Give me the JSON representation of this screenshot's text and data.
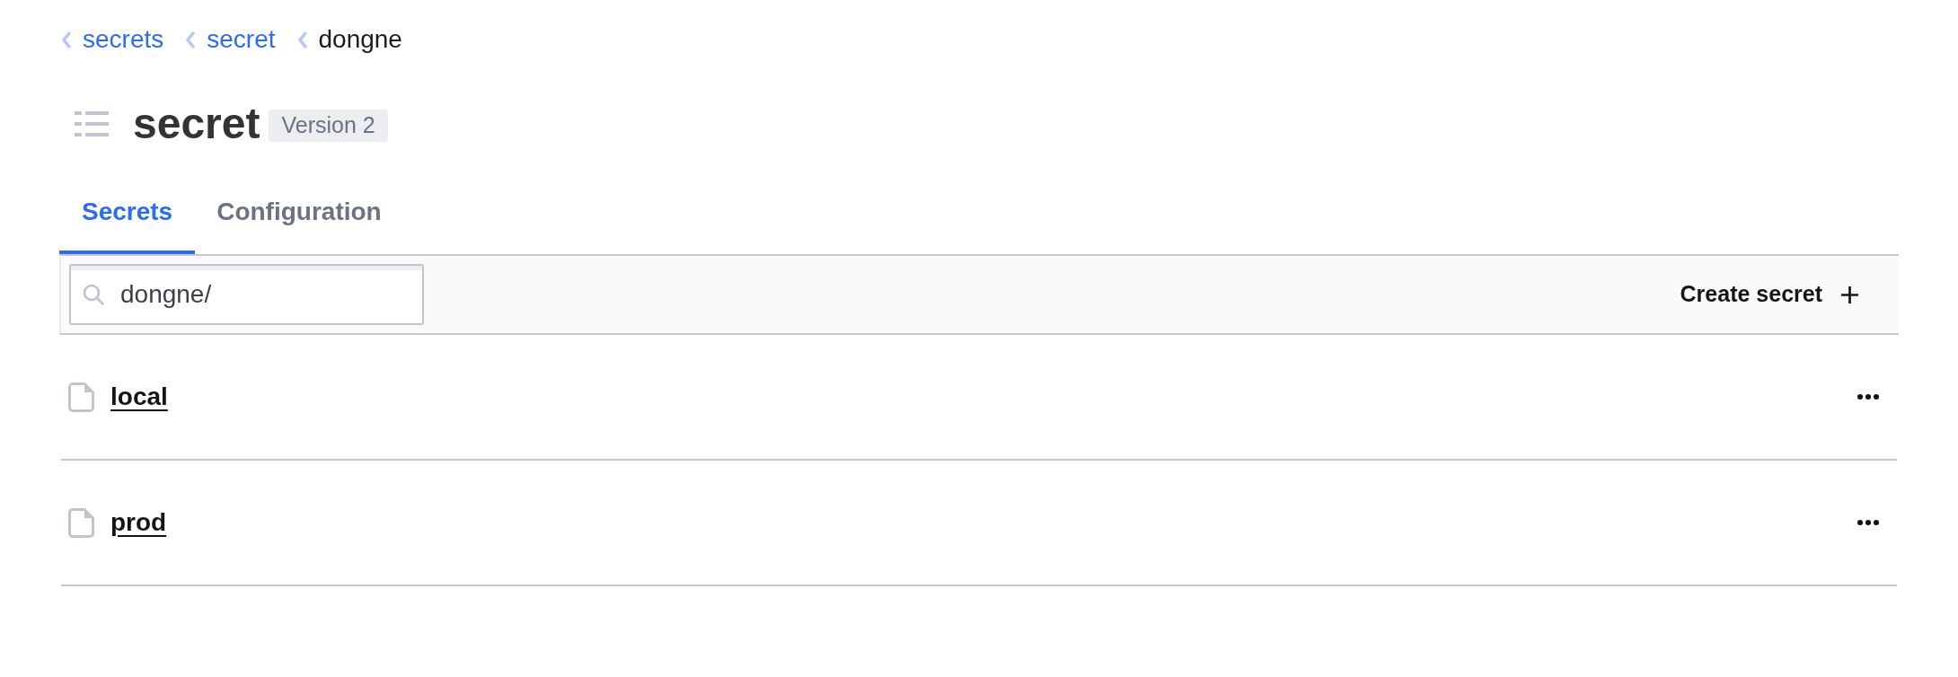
{
  "breadcrumbs": [
    {
      "label": "secrets",
      "kind": "link"
    },
    {
      "label": "secret",
      "kind": "link"
    },
    {
      "label": "dongne",
      "kind": "current"
    }
  ],
  "header": {
    "title": "secret",
    "badge": "Version 2"
  },
  "tabs": [
    {
      "label": "Secrets",
      "selected": true
    },
    {
      "label": "Configuration",
      "selected": false
    }
  ],
  "toolbar": {
    "search": {
      "value": "dongne/"
    },
    "create_button": "Create secret"
  },
  "secrets": [
    {
      "name": "local"
    },
    {
      "name": "prod"
    }
  ]
}
